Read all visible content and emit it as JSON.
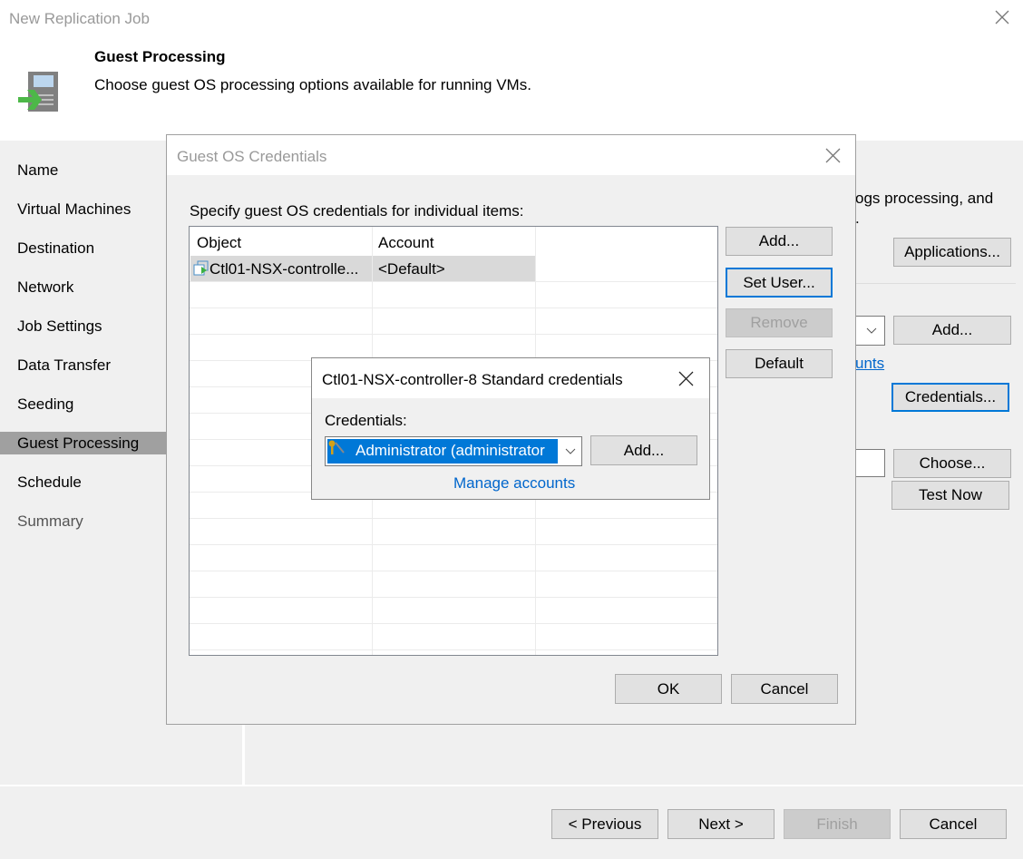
{
  "window": {
    "title": "New Replication Job"
  },
  "header": {
    "title": "Guest Processing",
    "subtitle": "Choose guest OS processing options available for running VMs."
  },
  "sidebar": {
    "items": [
      {
        "label": "Name"
      },
      {
        "label": "Virtual Machines"
      },
      {
        "label": "Destination"
      },
      {
        "label": "Network"
      },
      {
        "label": "Job Settings"
      },
      {
        "label": "Data Transfer"
      },
      {
        "label": "Seeding"
      },
      {
        "label": "Guest Processing",
        "active": true
      },
      {
        "label": "Schedule"
      },
      {
        "label": "Summary",
        "disabled": true
      }
    ]
  },
  "background": {
    "text_line1": "ogs processing, and",
    "text_line2": ".",
    "applications": "Applications...",
    "add": "Add...",
    "manage_link": "unts",
    "credentials": "Credentials...",
    "choose": "Choose...",
    "test_now": "Test Now"
  },
  "footer": {
    "previous": "< Previous",
    "next": "Next >",
    "finish": "Finish",
    "cancel": "Cancel"
  },
  "guest_dialog": {
    "title": "Guest OS Credentials",
    "instruction": "Specify guest OS credentials for individual items:",
    "columns": [
      "Object",
      "Account"
    ],
    "rows": [
      {
        "object": "Ctl01-NSX-controlle...",
        "account": "<Default>"
      }
    ],
    "buttons": {
      "add": "Add...",
      "set_user": "Set User...",
      "remove": "Remove",
      "default": "Default"
    },
    "ok": "OK",
    "cancel": "Cancel"
  },
  "cred_dialog": {
    "title": "Ctl01-NSX-controller-8 Standard credentials",
    "label": "Credentials:",
    "selected": "Administrator (administrator",
    "add": "Add...",
    "manage": "Manage accounts"
  },
  "colors": {
    "accent": "#0078d7",
    "selection": "#0078d7",
    "link": "#0066cc",
    "sidebar_active": "#a0a0a0"
  }
}
